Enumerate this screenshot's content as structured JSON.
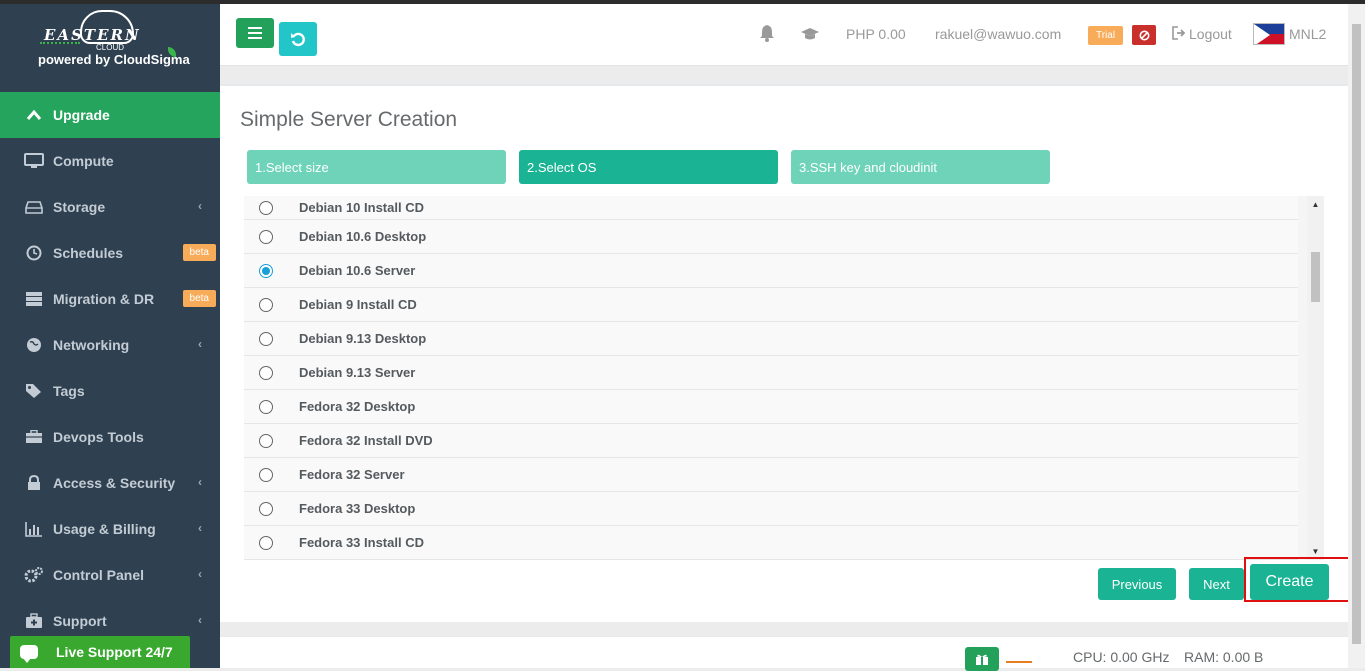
{
  "brand": {
    "logo_text": "EASTERN",
    "logo_sub": "CLOUD",
    "powered_by": "powered by CloudSigma"
  },
  "sidebar": {
    "items": [
      {
        "label": "Upgrade",
        "icon": "chevron-up-icon"
      },
      {
        "label": "Compute",
        "icon": "monitor-icon"
      },
      {
        "label": "Storage",
        "icon": "hdd-icon"
      },
      {
        "label": "Schedules",
        "icon": "clock-icon",
        "badge": "beta"
      },
      {
        "label": "Migration & DR",
        "icon": "server-icon",
        "badge": "beta"
      },
      {
        "label": "Networking",
        "icon": "globe-icon"
      },
      {
        "label": "Tags",
        "icon": "tags-icon"
      },
      {
        "label": "Devops Tools",
        "icon": "toolbox-icon"
      },
      {
        "label": "Access & Security",
        "icon": "lock-icon"
      },
      {
        "label": "Usage & Billing",
        "icon": "bar-chart-icon"
      },
      {
        "label": "Control Panel",
        "icon": "cogs-icon"
      },
      {
        "label": "Support",
        "icon": "medkit-icon"
      }
    ],
    "live_support": "Live Support 24/7"
  },
  "header": {
    "balance": "PHP 0.00",
    "email": "rakuel@wawuo.com",
    "trial": "Trial",
    "logout": "Logout",
    "region": "MNL2"
  },
  "main": {
    "title": "Simple Server Creation",
    "steps": [
      "1.Select size",
      "2.Select OS",
      "3.SSH key and cloudinit"
    ],
    "os_options": [
      {
        "label": "Debian 10 Install CD",
        "selected": false
      },
      {
        "label": "Debian 10.6 Desktop",
        "selected": false
      },
      {
        "label": "Debian 10.6 Server",
        "selected": true
      },
      {
        "label": "Debian 9 Install CD",
        "selected": false
      },
      {
        "label": "Debian 9.13 Desktop",
        "selected": false
      },
      {
        "label": "Debian 9.13 Server",
        "selected": false
      },
      {
        "label": "Fedora 32 Desktop",
        "selected": false
      },
      {
        "label": "Fedora 32 Install DVD",
        "selected": false
      },
      {
        "label": "Fedora 32 Server",
        "selected": false
      },
      {
        "label": "Fedora 33 Desktop",
        "selected": false
      },
      {
        "label": "Fedora 33 Install CD",
        "selected": false
      }
    ],
    "buttons": {
      "previous": "Previous",
      "next": "Next",
      "create": "Create"
    }
  },
  "footer": {
    "cpu": "CPU: 0.00 GHz",
    "ram": "RAM: 0.00 B"
  },
  "colors": {
    "sidebar_bg": "#2f4050",
    "active_green": "#25a45d",
    "teal": "#1ab394",
    "teal_light": "#6ed3b9",
    "badge_orange": "#f8ac59",
    "highlight_red": "#e01010"
  }
}
